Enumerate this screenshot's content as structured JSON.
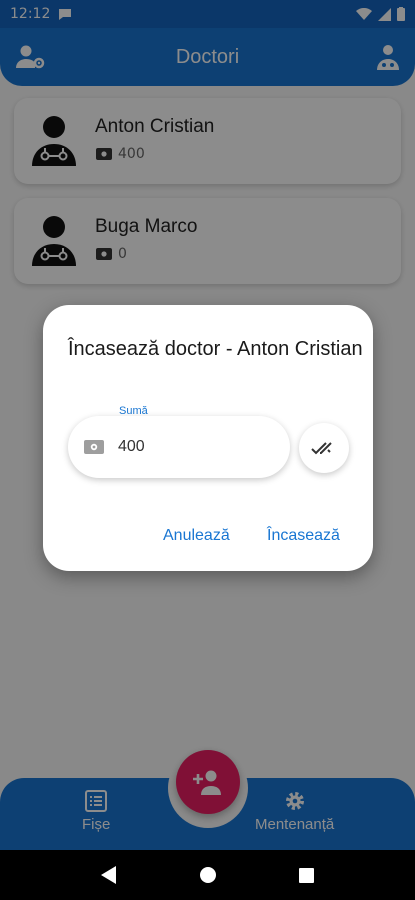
{
  "status_bar": {
    "time": "12:12"
  },
  "app_bar": {
    "title": "Doctori"
  },
  "doctors": [
    {
      "name": "Anton Cristian",
      "balance": "400"
    },
    {
      "name": "Buga Marco",
      "balance": "0"
    }
  ],
  "bottom_nav": {
    "items": [
      {
        "label": "Fișe",
        "icon": "list-icon"
      },
      {
        "label": "Mentenanță",
        "icon": "gear-icon"
      }
    ],
    "fab_icon": "add-person-icon"
  },
  "dialog": {
    "title": "Încasează doctor - Anton Cristian",
    "field_label": "Sumă",
    "field_value": "400",
    "cancel_label": "Anulează",
    "confirm_label": "Încasează"
  },
  "colors": {
    "primary": "#1976d2",
    "fab": "#e91e63"
  }
}
